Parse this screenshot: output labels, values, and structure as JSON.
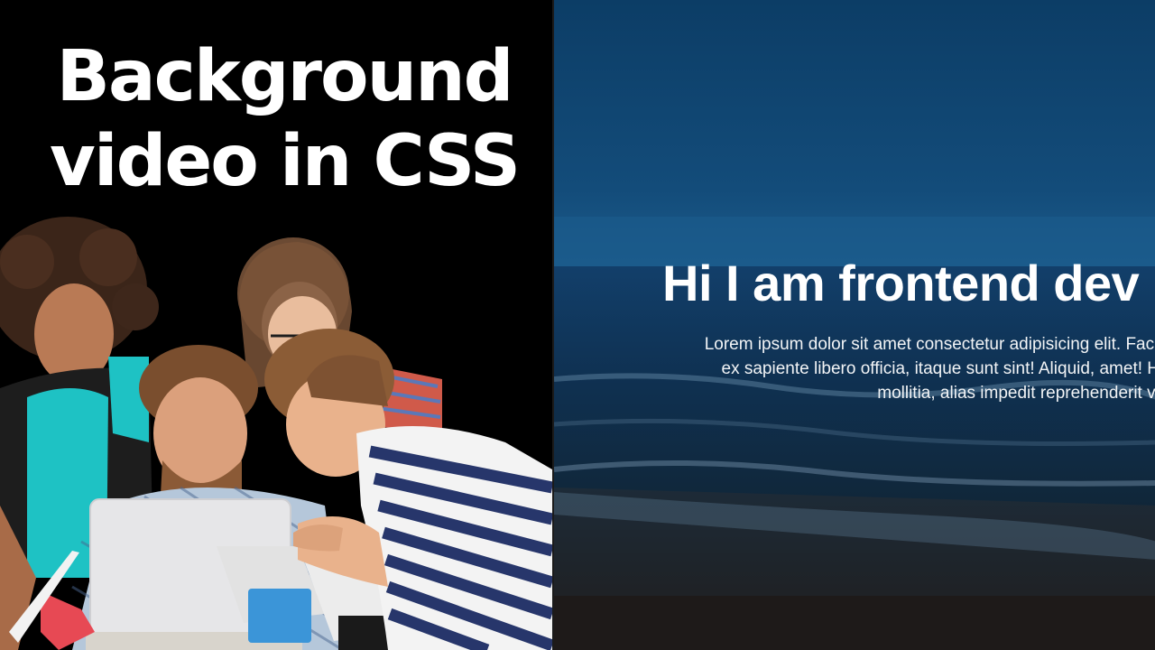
{
  "thumbnail": {
    "headline_line1": "Background",
    "headline_line2": "video in CSS",
    "question_mark": "?",
    "accent_color": "#f9d43a"
  },
  "video_preview": {
    "title": "Hi I am frontend dev",
    "description_line1": "Lorem ipsum dolor sit amet consectetur adipisicing elit. Facilis",
    "description_line2": "ex sapiente libero officia, itaque sunt sint! Aliquid, amet! Haru",
    "description_line3": "mollitia, alias impedit reprehenderit vero ma",
    "scene": "ocean-beach-video"
  }
}
